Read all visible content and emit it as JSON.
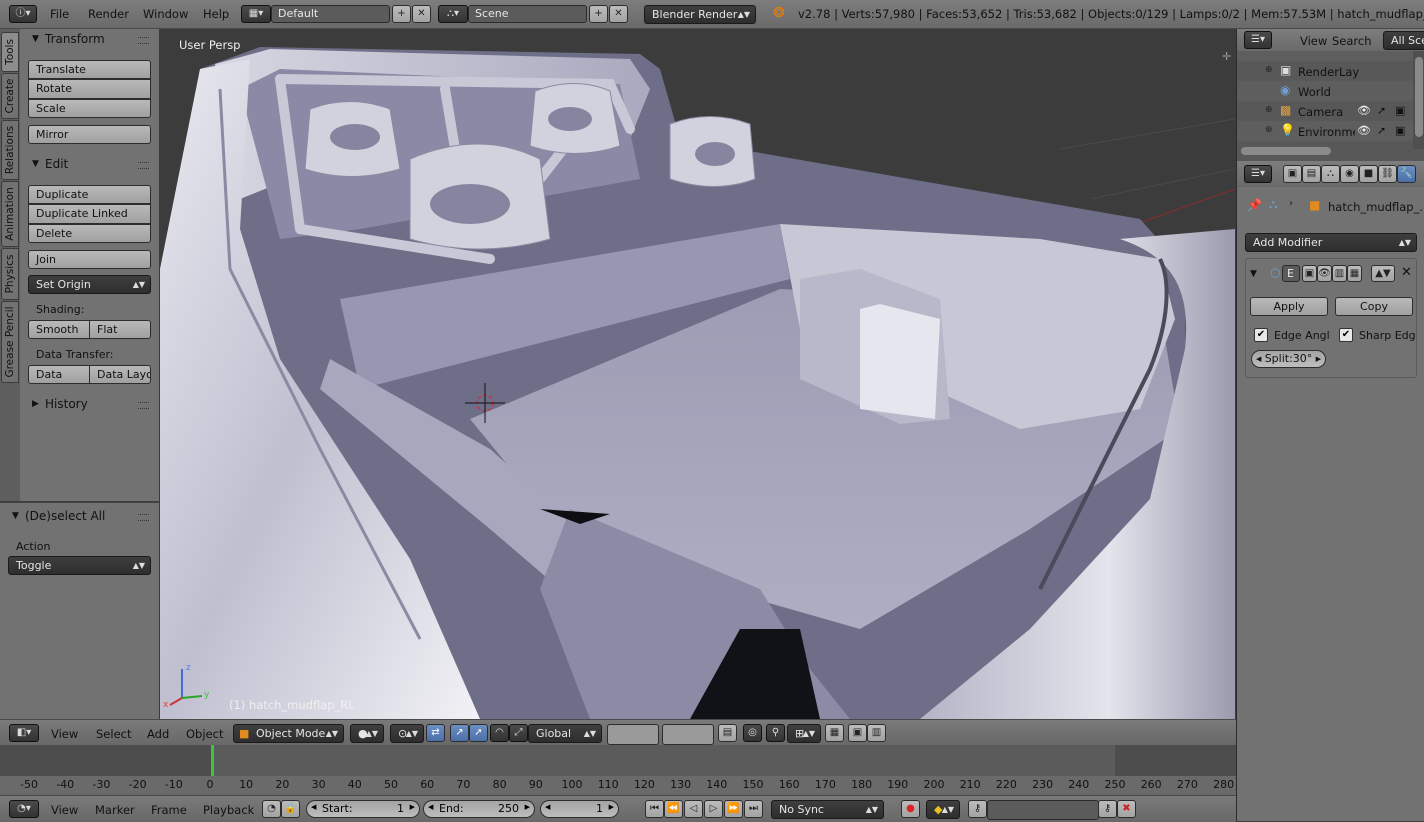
{
  "topbar": {
    "menus": [
      "File",
      "Render",
      "Window",
      "Help"
    ],
    "screen_layout": "Default",
    "scene": "Scene",
    "render_engine": "Blender Render",
    "stats": "v2.78 | Verts:57,980 | Faces:53,652 | Tris:53,682 | Objects:0/129 | Lamps:0/2 | Mem:57.53M | hatch_mudflap_RL"
  },
  "tool_tabs": [
    "Tools",
    "Create",
    "Relations",
    "Animation",
    "Physics",
    "Grease Pencil"
  ],
  "tool_shelf": {
    "transform": {
      "title": "Transform",
      "buttons": [
        "Translate",
        "Rotate",
        "Scale",
        "Mirror"
      ]
    },
    "edit": {
      "title": "Edit",
      "buttons": [
        "Duplicate",
        "Duplicate Linked",
        "Delete",
        "Join"
      ],
      "set_origin": "Set Origin",
      "shading_label": "Shading:",
      "smooth": "Smooth",
      "flat": "Flat",
      "data_transfer_label": "Data Transfer:",
      "data": "Data",
      "data_layout": "Data Layo"
    },
    "history": {
      "title": "History"
    }
  },
  "redo_panel": {
    "title": "(De)select All",
    "action_label": "Action",
    "action_value": "Toggle"
  },
  "viewport": {
    "view_label": "User Persp",
    "object_label": "(1) hatch_mudflap_RL",
    "axis_x": "x",
    "axis_y": "y",
    "axis_z": "z"
  },
  "view3d_header": {
    "menus": [
      "View",
      "Select",
      "Add",
      "Object"
    ],
    "mode": "Object Mode",
    "orientation": "Global"
  },
  "timeline": {
    "ticks": [
      "-50",
      "-40",
      "-30",
      "-20",
      "-10",
      "0",
      "10",
      "20",
      "30",
      "40",
      "50",
      "60",
      "70",
      "80",
      "90",
      "100",
      "110",
      "120",
      "130",
      "140",
      "150",
      "160",
      "170",
      "180",
      "190",
      "200",
      "210",
      "220",
      "230",
      "240",
      "250",
      "260",
      "270",
      "280"
    ],
    "current_frame_value": 1,
    "menus": [
      "View",
      "Marker",
      "Frame",
      "Playback"
    ],
    "start_label": "Start:",
    "start_value": "1",
    "end_label": "End:",
    "end_value": "250",
    "current_frame": "1",
    "sync": "No Sync"
  },
  "outliner": {
    "menus": [
      "View",
      "Search"
    ],
    "filter": "All Sce",
    "items": [
      {
        "label": "RenderLay"
      },
      {
        "label": "World"
      },
      {
        "label": "Camera"
      },
      {
        "label": "Environme"
      }
    ]
  },
  "properties": {
    "object_name": "hatch_mudflap_...",
    "add_modifier": "Add Modifier",
    "modifier_short": "E",
    "apply": "Apply",
    "copy": "Copy",
    "edge_angle": "Edge Angl",
    "sharp_edges": "Sharp Edg",
    "split_angle": "Split:30°"
  },
  "colors": {
    "accent_blue": "#5680c2",
    "frame_green": "#3cc43c",
    "header_gray": "#727272"
  }
}
